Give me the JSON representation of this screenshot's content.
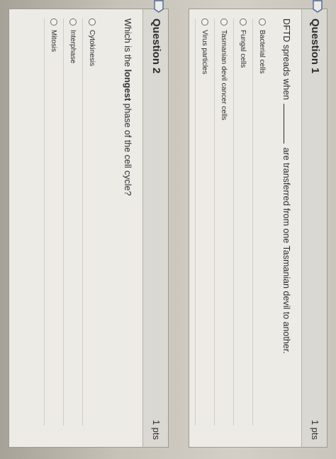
{
  "questions": [
    {
      "title": "Question 1",
      "points": "1 pts",
      "text_before": "DFTD spreads when",
      "text_after": "are transferred from one Tasmanian devil to another.",
      "answers": [
        "Bacterial cells",
        "Fungal cells",
        "Tasmanian devil cancer cells",
        "Virus particles"
      ]
    },
    {
      "title": "Question 2",
      "points": "1 pts",
      "text_before": "Which is the",
      "text_bold": "longest",
      "text_after": "phase of the cell cycle?",
      "answers": [
        "Cytokinesis",
        "Interphase",
        "Mitosis"
      ]
    }
  ],
  "icons": {
    "flag": "flag-outline-icon",
    "radio": "radio-button-unselected"
  },
  "colors": {
    "card_background": "#ecebe6",
    "header_background": "#dad8d2",
    "text": "#2c2d30"
  }
}
